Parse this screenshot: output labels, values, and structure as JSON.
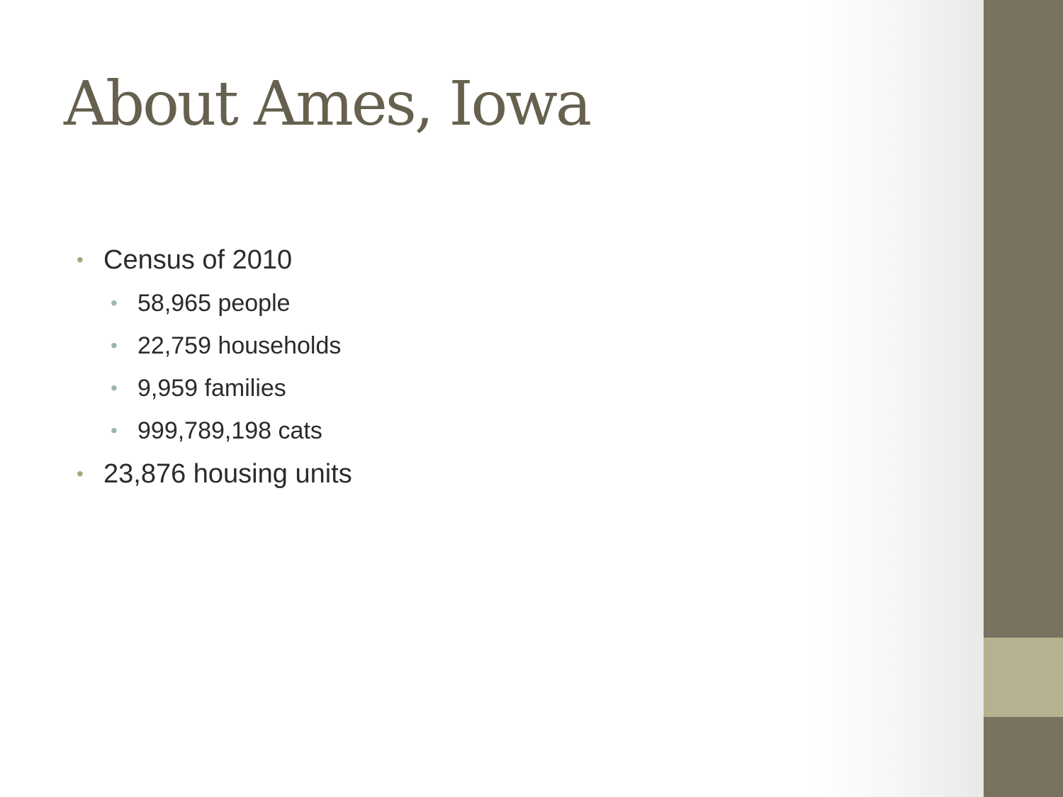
{
  "slide": {
    "title": "About Ames, Iowa",
    "bullets": [
      {
        "text": "Census of 2010",
        "sub": [
          {
            "text": "58,965 people"
          },
          {
            "text": "22,759 households"
          },
          {
            "text": "9,959 families"
          },
          {
            "text": "999,789,198 cats"
          }
        ]
      },
      {
        "text": "23,876 housing units"
      }
    ]
  },
  "theme": {
    "title_color": "#66604f",
    "text_color": "#2b2b2b",
    "bullet_l1_color": "#a8a67f",
    "bullet_l2_color": "#9fb3b5",
    "side_bar_color": "#787260",
    "side_accent_color": "#b6b28f",
    "bullet_glyph": "•"
  }
}
